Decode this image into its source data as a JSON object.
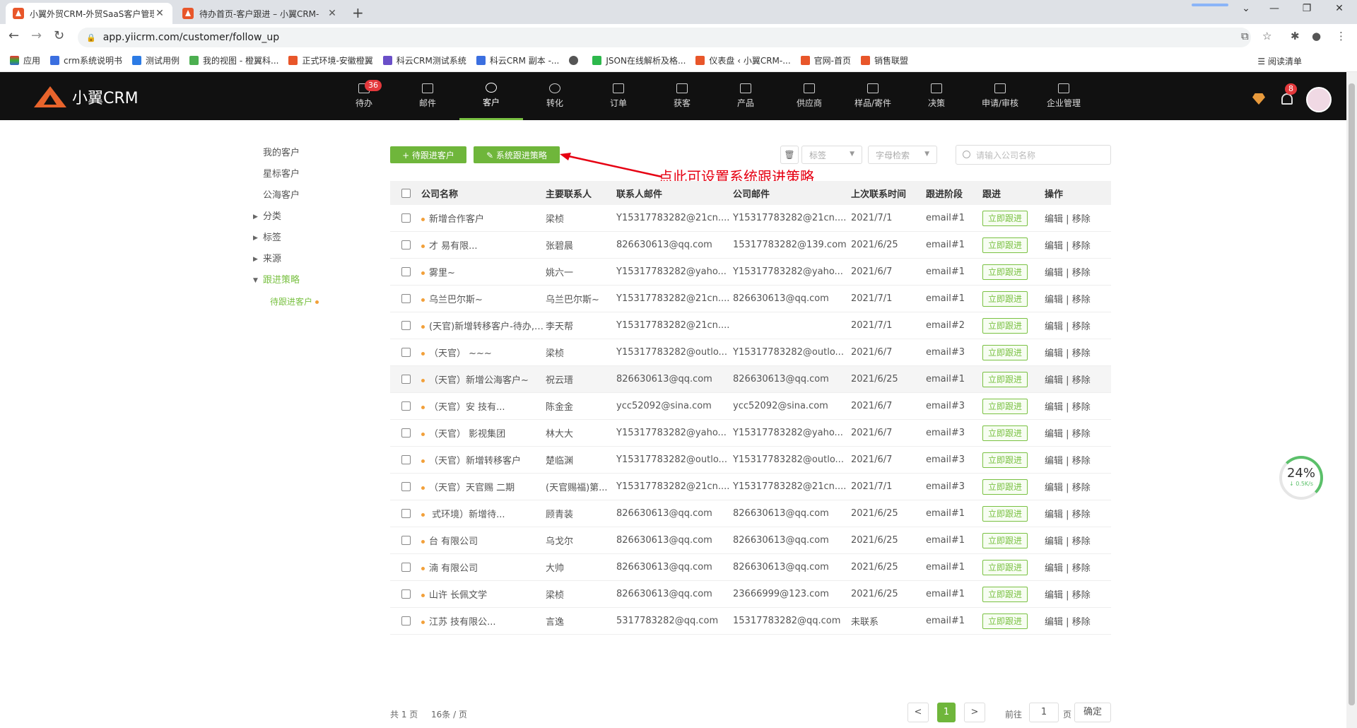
{
  "browser": {
    "tabs": [
      {
        "title": "小翼外贸CRM-外贸SaaS客户管理",
        "active": true
      },
      {
        "title": "待办首页-客户跟进 – 小翼CRM-",
        "active": false
      }
    ],
    "url": "app.yiicrm.com/customer/follow_up",
    "bookmarks": [
      "应用",
      "crm系统说明书",
      "测试用例",
      "我的视图 - 橙翼科...",
      "正式环境-安徽橙翼",
      "科云CRM测试系统",
      "科云CRM 副本 -...",
      "",
      "JSON在线解析及格...",
      "仪表盘 ‹ 小翼CRM-...",
      "官网-首页",
      "销售联盟"
    ],
    "reading_list": "阅读清单"
  },
  "header": {
    "logo_text": "小翼CRM",
    "nav": [
      {
        "label": "待办",
        "badge": "36"
      },
      {
        "label": "邮件"
      },
      {
        "label": "客户",
        "active": true
      },
      {
        "label": "转化"
      },
      {
        "label": "订单"
      },
      {
        "label": "获客"
      },
      {
        "label": "产品"
      },
      {
        "label": "供应商"
      },
      {
        "label": "样品/寄件"
      },
      {
        "label": "决策"
      },
      {
        "label": "申请/审核"
      },
      {
        "label": "企业管理"
      }
    ],
    "bell_badge": "8"
  },
  "sidebar": {
    "items": [
      {
        "label": "我的客户"
      },
      {
        "label": "星标客户"
      },
      {
        "label": "公海客户"
      },
      {
        "label": "分类",
        "caret": "▶"
      },
      {
        "label": "标签",
        "caret": "▶"
      },
      {
        "label": "来源",
        "caret": "▶"
      },
      {
        "label": "跟进策略",
        "caret": "▼"
      }
    ],
    "sub_item": "待跟进客户"
  },
  "controls": {
    "btn_pending": "+ 待跟进客户",
    "btn_strategy": "✎ 系统跟进策略",
    "tag_select": "标签",
    "letter_select": "字母检索",
    "search_placeholder": "请输入公司名称",
    "annotation": "点此可设置系统跟进策略"
  },
  "table": {
    "headers": {
      "company": "公司名称",
      "contact": "主要联系人",
      "contact_email": "联系人邮件",
      "company_email": "公司邮件",
      "last_contact": "上次联系时间",
      "stage": "跟进阶段",
      "follow": "跟进",
      "op": "操作"
    },
    "follow_btn": "立即跟进",
    "op_edit": "编辑",
    "op_sep": "|",
    "op_remove": "移除",
    "rows": [
      {
        "company": "新增合作客户",
        "contact": "梁桢",
        "contact_email": "Y15317783282@21cn....",
        "company_email": "Y15317783282@21cn....",
        "last": "2021/7/1",
        "stage": "email#1"
      },
      {
        "company": "才        易有限...",
        "contact": "张碧晨",
        "contact_email": "826630613@qq.com",
        "company_email": "15317783282@139.com",
        "last": "2021/6/25",
        "stage": "email#1"
      },
      {
        "company": "雾里~",
        "contact": "姚六一",
        "contact_email": "Y15317783282@yaho...",
        "company_email": "Y15317783282@yaho...",
        "last": "2021/6/7",
        "stage": "email#1"
      },
      {
        "company": "乌兰巴尔斯~",
        "contact": "乌兰巴尔斯~",
        "contact_email": "Y15317783282@21cn....",
        "company_email": "826630613@qq.com",
        "last": "2021/7/1",
        "stage": "email#1"
      },
      {
        "company": "(天官)新增转移客户-待办, ...",
        "contact": "李天帮",
        "contact_email": "Y15317783282@21cn....",
        "company_email": "",
        "last": "2021/7/1",
        "stage": "email#2"
      },
      {
        "company": "（天官）     ~~~",
        "contact": "梁桢",
        "contact_email": "Y15317783282@outlo...",
        "company_email": "Y15317783282@outlo...",
        "last": "2021/6/7",
        "stage": "email#3"
      },
      {
        "company": "（天官）新增公海客户~",
        "contact": "祝云瑨",
        "contact_email": "826630613@qq.com",
        "company_email": "826630613@qq.com",
        "last": "2021/6/25",
        "stage": "email#1",
        "hl": true
      },
      {
        "company": "（天官）安      技有...",
        "contact": "陈金金",
        "contact_email": "ycc52092@sina.com",
        "company_email": "ycc52092@sina.com",
        "last": "2021/6/7",
        "stage": "email#3"
      },
      {
        "company": "（天官）   影视集团",
        "contact": "林大大",
        "contact_email": "Y15317783282@yaho...",
        "company_email": "Y15317783282@yaho...",
        "last": "2021/6/7",
        "stage": "email#3"
      },
      {
        "company": "（天官）新增转移客户",
        "contact": "楚临渊",
        "contact_email": "Y15317783282@outlo...",
        "company_email": "Y15317783282@outlo...",
        "last": "2021/6/7",
        "stage": "email#3"
      },
      {
        "company": "（天官）天官赐    二期",
        "contact": "(天官赐福)第...",
        "contact_email": "Y15317783282@21cn....",
        "company_email": "Y15317783282@21cn....",
        "last": "2021/7/1",
        "stage": "email#3"
      },
      {
        "company": "      式环境）新增待...",
        "contact": "顾青装",
        "contact_email": "826630613@qq.com",
        "company_email": "826630613@qq.com",
        "last": "2021/6/25",
        "stage": "email#1"
      },
      {
        "company": "台       有限公司",
        "contact": "乌戈尔",
        "contact_email": "826630613@qq.com",
        "company_email": "826630613@qq.com",
        "last": "2021/6/25",
        "stage": "email#1"
      },
      {
        "company": "湳     有限公司",
        "contact": "大帅",
        "contact_email": "826630613@qq.com",
        "company_email": "826630613@qq.com",
        "last": "2021/6/25",
        "stage": "email#1"
      },
      {
        "company": "山许   长佩文学",
        "contact": "梁桢",
        "contact_email": "826630613@qq.com",
        "company_email": "23666999@123.com",
        "last": "2021/6/25",
        "stage": "email#1"
      },
      {
        "company": "江苏      技有限公...",
        "contact": "言逸",
        "contact_email": "5317783282@qq.com",
        "company_email": "15317783282@qq.com",
        "last": "未联系",
        "stage": "email#1"
      }
    ]
  },
  "pagination": {
    "total_pages": "共 1 页",
    "per_page": "16条 / 页",
    "prev": "<",
    "current": "1",
    "next": ">",
    "goto": "前往",
    "goto_value": "1",
    "page_unit": "页",
    "confirm": "确定"
  },
  "speed_widget": {
    "percent": "24%",
    "rate": "↓ 0.5K/s"
  },
  "colors": {
    "accent": "#6fb63b",
    "header_bg": "#111111",
    "badge": "#e4393c",
    "annotation": "#e60012",
    "dot": "#f2a03a"
  }
}
